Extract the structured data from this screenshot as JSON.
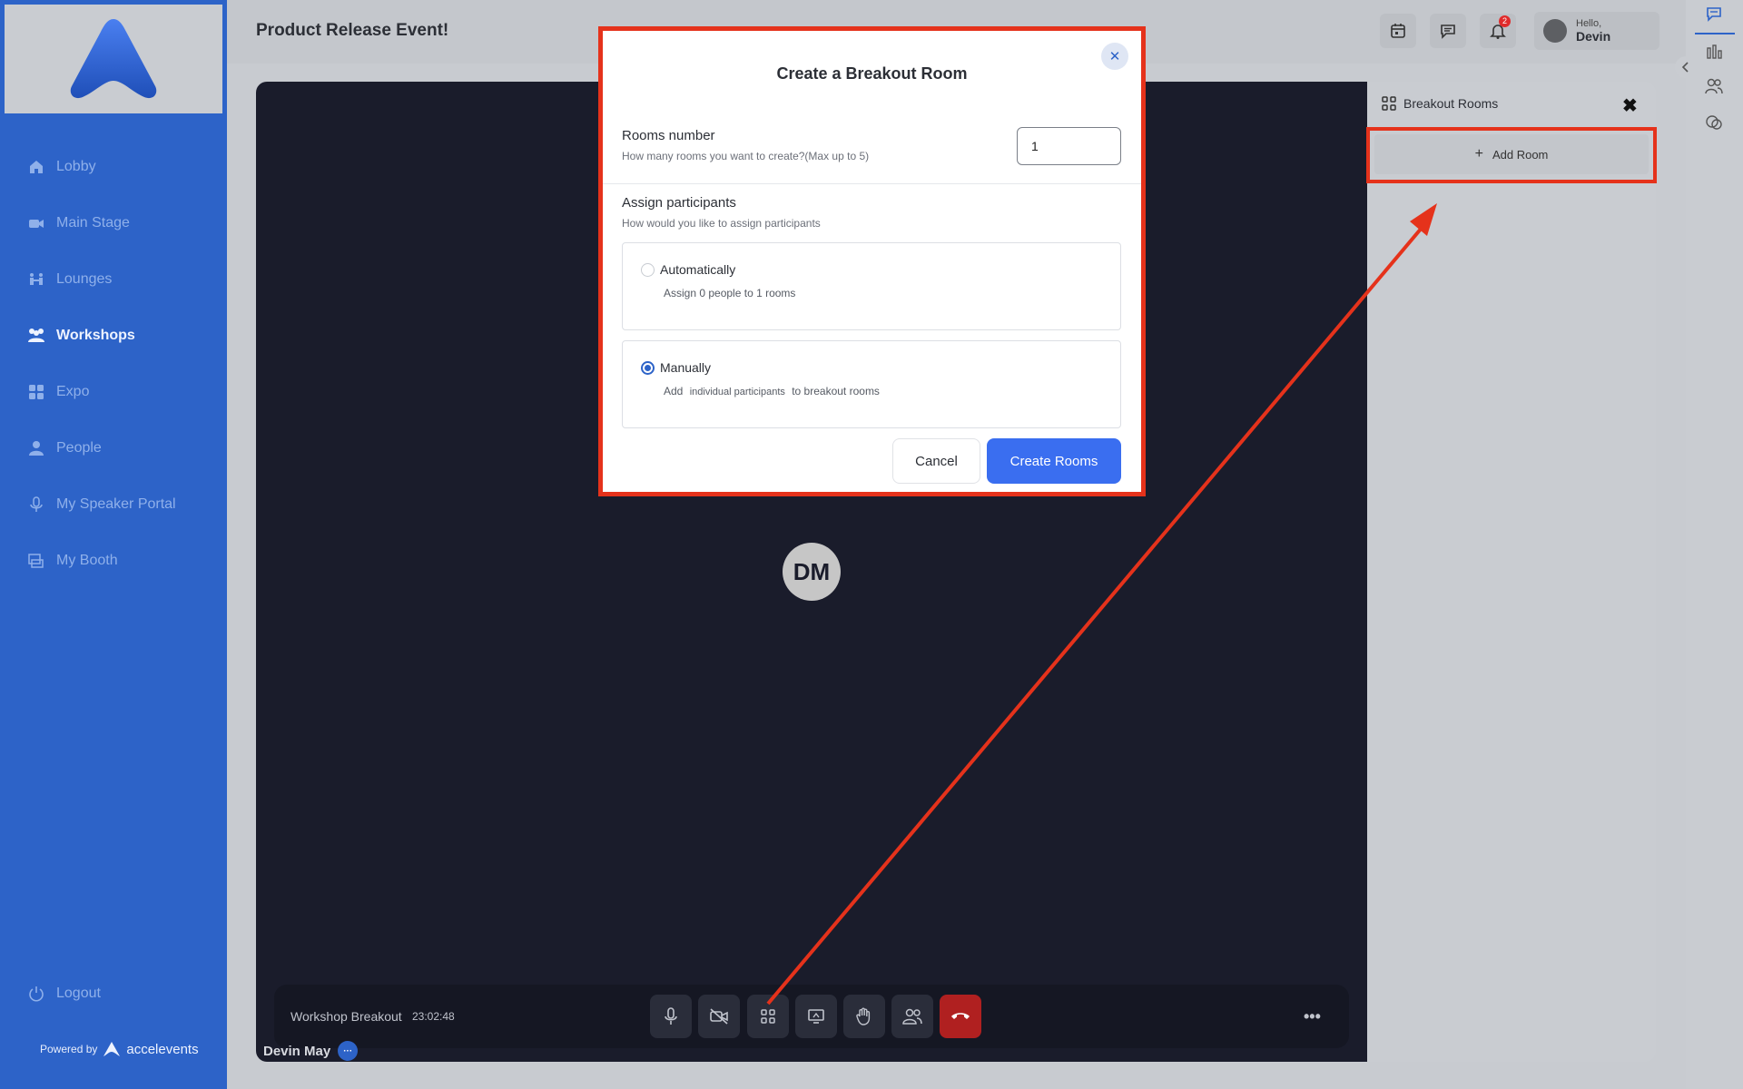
{
  "app": {
    "title": "Product Release Event!",
    "notification_count": "2",
    "user": {
      "greeting": "Hello,",
      "name": "Devin"
    }
  },
  "sidebar": {
    "items": [
      {
        "label": "Lobby",
        "icon": "home-icon",
        "active": false
      },
      {
        "label": "Main Stage",
        "icon": "video-camera-icon",
        "active": false
      },
      {
        "label": "Lounges",
        "icon": "lounge-icon",
        "active": false
      },
      {
        "label": "Workshops",
        "icon": "people-group-icon",
        "active": true
      },
      {
        "label": "Expo",
        "icon": "grid-icon",
        "active": false
      },
      {
        "label": "People",
        "icon": "person-icon",
        "active": false
      },
      {
        "label": "My Speaker Portal",
        "icon": "microphone-icon",
        "active": false
      },
      {
        "label": "My Booth",
        "icon": "booth-icon",
        "active": false
      }
    ],
    "logout_label": "Logout",
    "powered_by": "Powered by",
    "brand": "accelevents"
  },
  "video": {
    "participant_initials": "DM",
    "session_label": "Workshop Breakout",
    "elapsed": "23:02:48",
    "speaker_name": "Devin May",
    "controls": [
      "microphone-icon",
      "video-off-icon",
      "breakout-grid-icon",
      "screen-share-icon",
      "raise-hand-icon",
      "participants-icon",
      "end-call-icon"
    ],
    "more_label": "•••"
  },
  "breakout_panel": {
    "title": "Breakout Rooms",
    "add_room_label": "Add Room"
  },
  "modal": {
    "title": "Create a Breakout Room",
    "rooms_number_label": "Rooms number",
    "rooms_number_hint": "How many rooms you want to create?(Max up to 5)",
    "rooms_number_value": "1",
    "assign_label": "Assign participants",
    "assign_hint": "How would you like to assign participants",
    "options": [
      {
        "label": "Automatically",
        "description": "Assign 0 people to 1 rooms",
        "checked": false
      },
      {
        "label": "Manually",
        "desc_prefix": "Add",
        "desc_chip": "individual participants",
        "desc_suffix": "to breakout rooms",
        "checked": true
      }
    ],
    "cancel_label": "Cancel",
    "create_label": "Create Rooms"
  },
  "colors": {
    "sidebar": "#2d63c8",
    "accent": "#3a6ef0",
    "highlight": "#e5321b",
    "video_bg": "#1a1c2b",
    "end_call": "#b02020"
  }
}
